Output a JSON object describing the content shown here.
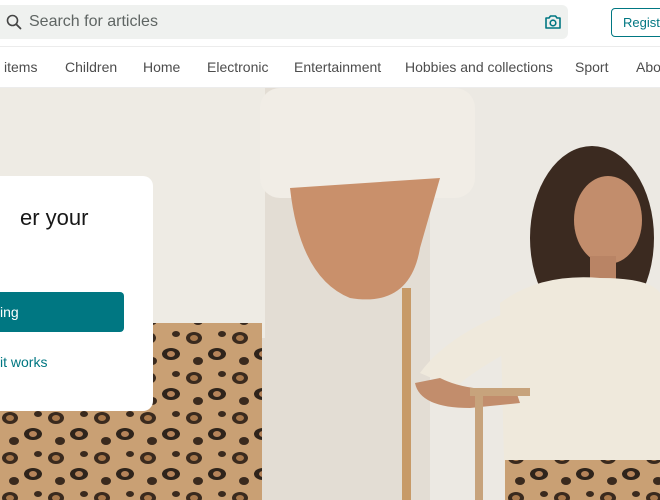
{
  "search": {
    "placeholder": "Search for articles"
  },
  "header": {
    "register_label": "Registe"
  },
  "categories": [
    "items",
    "Children",
    "Home",
    "Electronic",
    "Entertainment",
    "Hobbies and collections",
    "Sport",
    "Abo"
  ],
  "hero": {
    "title": "er your",
    "cta_label": "ing",
    "link_label": "it works"
  },
  "colors": {
    "accent": "#007782",
    "search_bg": "#eff1ef"
  },
  "icons": [
    "search-icon",
    "camera-icon"
  ]
}
